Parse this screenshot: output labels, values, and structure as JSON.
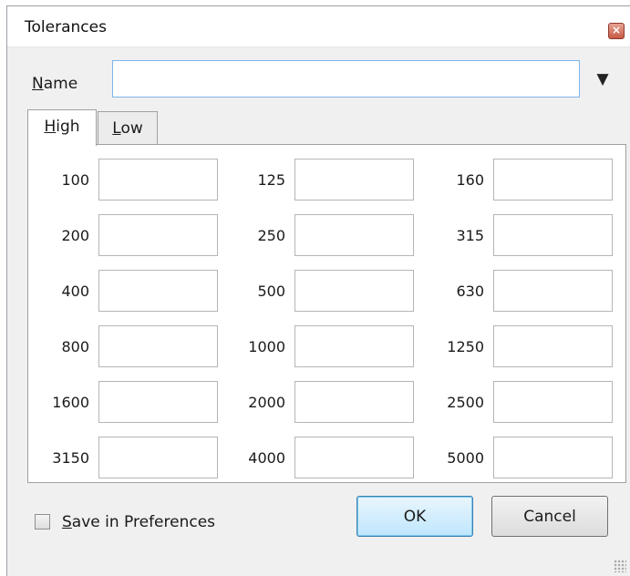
{
  "window": {
    "title": "Tolerances",
    "close_icon": "×"
  },
  "name_field": {
    "label_underlined": "N",
    "label_rest": "ame",
    "value": "",
    "dropdown_icon": "▼"
  },
  "tabs": [
    {
      "underlined": "H",
      "rest": "igh",
      "active": true
    },
    {
      "underlined": "L",
      "rest": "ow",
      "active": false
    }
  ],
  "grid": [
    [
      "100",
      "125",
      "160"
    ],
    [
      "200",
      "250",
      "315"
    ],
    [
      "400",
      "500",
      "630"
    ],
    [
      "800",
      "1000",
      "1250"
    ],
    [
      "1600",
      "2000",
      "2500"
    ],
    [
      "3150",
      "4000",
      "5000"
    ]
  ],
  "save_prefs": {
    "underlined": "S",
    "rest": "ave in Preferences",
    "checked": false
  },
  "buttons": {
    "ok": "OK",
    "cancel": "Cancel"
  }
}
